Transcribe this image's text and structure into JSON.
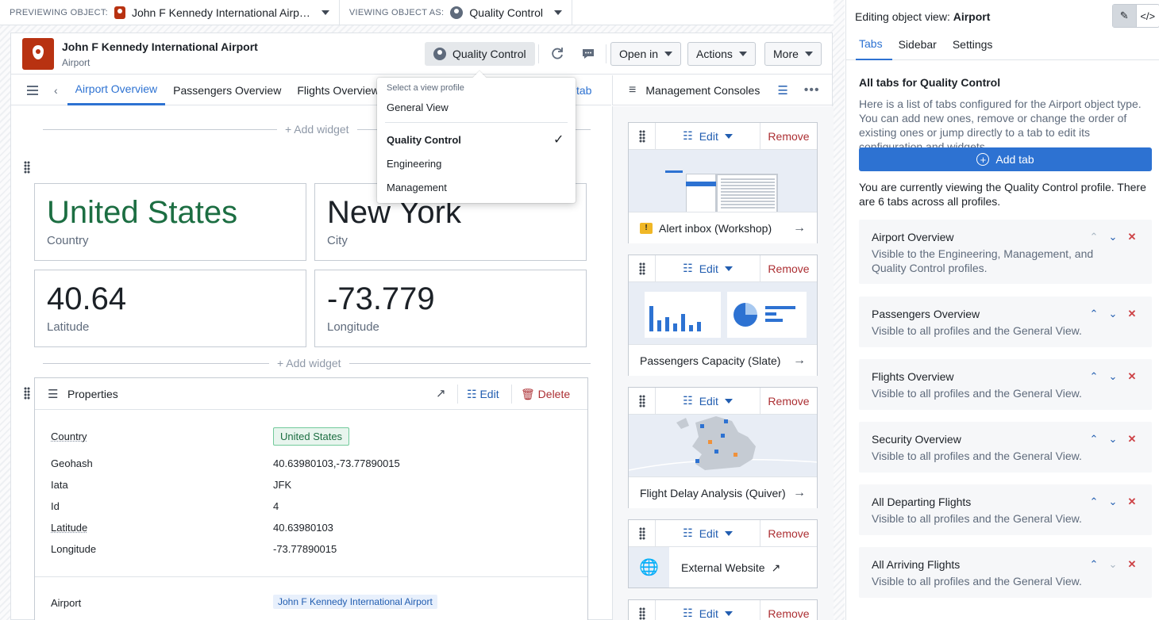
{
  "topbar": {
    "previewing_label": "PREVIEWING OBJECT:",
    "previewing_value": "John F Kennedy International Airp…",
    "viewing_as_label": "VIEWING OBJECT AS:",
    "viewing_as_value": "Quality Control"
  },
  "object": {
    "title": "John F Kennedy International Airport",
    "type": "Airport",
    "profile_button": "Quality Control",
    "open_in": "Open in",
    "actions": "Actions",
    "more": "More"
  },
  "tabs": {
    "items": [
      "Airport Overview",
      "Passengers Overview",
      "Flights Overview"
    ],
    "add_tab_partial": "tab"
  },
  "profile_menu": {
    "header": "Select a view profile",
    "general": "General View",
    "items": [
      "Quality Control",
      "Engineering",
      "Management"
    ]
  },
  "widgets": {
    "add_widget": "+ Add widget",
    "cards": [
      {
        "value": "United States",
        "label": "Country"
      },
      {
        "value": "New York",
        "label": "City"
      },
      {
        "value": "40.64",
        "label": "Latitude"
      },
      {
        "value": "-73.779",
        "label": "Longitude"
      }
    ]
  },
  "properties": {
    "title": "Properties",
    "edit": "Edit",
    "delete": "Delete",
    "rows": [
      {
        "key": "Country",
        "value": "United States"
      },
      {
        "key": "Geohash",
        "value": "40.63980103,-73.77890015"
      },
      {
        "key": "Iata",
        "value": "JFK"
      },
      {
        "key": "Id",
        "value": "4"
      },
      {
        "key": "Latitude",
        "value": "40.63980103"
      },
      {
        "key": "Longitude",
        "value": "-73.77890015"
      }
    ],
    "airport_key": "Airport",
    "airport_value": "John F Kennedy International Airport"
  },
  "management": {
    "title": "Management Consoles",
    "edit": "Edit",
    "remove": "Remove",
    "widgets": [
      {
        "name": "Alert inbox (Workshop)"
      },
      {
        "name": "Passengers Capacity (Slate)"
      },
      {
        "name": "Flight Delay Analysis (Quiver)"
      },
      {
        "name": "External Website"
      }
    ]
  },
  "editor": {
    "title_prefix": "Editing object view: ",
    "title_obj": "Airport",
    "tabs": [
      "Tabs",
      "Sidebar",
      "Settings"
    ],
    "heading": "All tabs for Quality Control",
    "description": "Here is a list of tabs configured for the Airport object type. You can add new ones, remove or change the order of existing ones or jump directly to a tab to edit its configuration and widgets.",
    "add_tab": "Add tab",
    "note": "You are currently viewing the Quality Control profile. There are 6 tabs across all profiles.",
    "tab_list": [
      {
        "name": "Airport Overview",
        "desc": "Visible to the Engineering, Management, and Quality Control profiles."
      },
      {
        "name": "Passengers Overview",
        "desc": "Visible to all profiles and the General View."
      },
      {
        "name": "Flights Overview",
        "desc": "Visible to all profiles and the General View."
      },
      {
        "name": "Security Overview",
        "desc": "Visible to all profiles and the General View."
      },
      {
        "name": "All Departing Flights",
        "desc": "Visible to all profiles and the General View."
      },
      {
        "name": "All Arriving Flights",
        "desc": "Visible to all profiles and the General View."
      }
    ]
  },
  "colors": {
    "accent": "#2d72d2",
    "brand_pin": "#b83211",
    "danger": "#cd4246",
    "success_text": "#1c6e42"
  }
}
